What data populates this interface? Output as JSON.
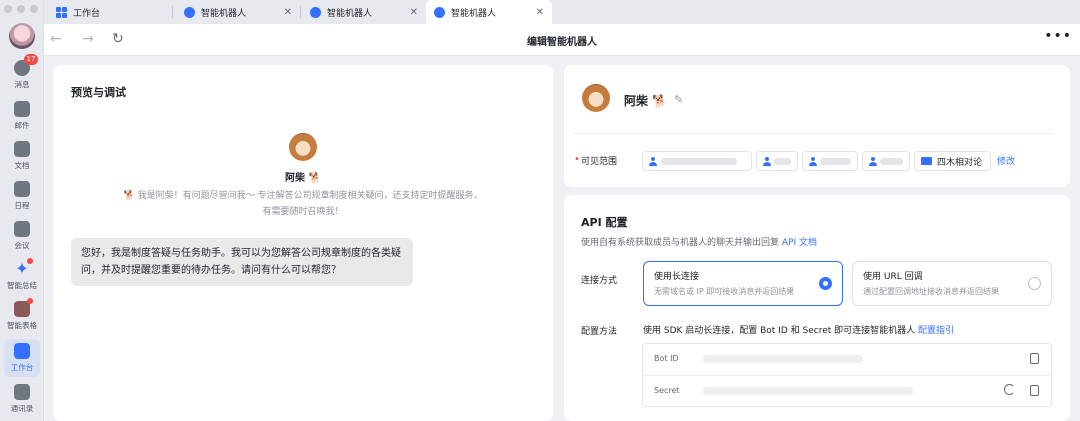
{
  "sidebar": {
    "badge_count": "17",
    "items": [
      {
        "label": "消息"
      },
      {
        "label": "邮件"
      },
      {
        "label": "文档"
      },
      {
        "label": "日程"
      },
      {
        "label": "会议"
      },
      {
        "label": "智能总结"
      },
      {
        "label": "智能表格"
      },
      {
        "label": "工作台"
      },
      {
        "label": "通讯录"
      }
    ]
  },
  "tabs": [
    {
      "label": "工作台"
    },
    {
      "label": "智能机器人"
    },
    {
      "label": "智能机器人"
    },
    {
      "label": "智能机器人"
    }
  ],
  "toolbar": {
    "title": "编辑智能机器人",
    "more": "•••",
    "back": "←",
    "forward": "→",
    "reload": "↻"
  },
  "preview": {
    "title": "预览与调试",
    "bot_name": "阿柴 🐕",
    "intro_line1": "🐕 我是阿柴！有问题尽管问我～ 专注解答公司规章制度相关疑问，还支持定时提醒服务，",
    "intro_line2": "有需要随时召唤我！",
    "message": "您好，我是制度答疑与任务助手。我可以为您解答公司规章制度的各类疑问，并及时提醒您重要的待办任务。请问有什么可以帮您？"
  },
  "bot": {
    "name": "阿柴 🐕",
    "edit_icon": "✎",
    "scope_label": "可见范围",
    "required_mark": "•",
    "group_chip": "四木相对论",
    "modify_link": "修改"
  },
  "api": {
    "title": "API 配置",
    "desc": "使用自有系统获取成员与机器人的聊天并输出回复",
    "doc_link": "API 文档",
    "connection_label": "连接方式",
    "options": [
      {
        "title": "使用长连接",
        "desc": "无需域名或 IP 即可接收消息并返回结果",
        "selected": true
      },
      {
        "title": "使用 URL 回调",
        "desc": "通过配置回调地址接收消息并返回结果",
        "selected": false
      }
    ],
    "config_label": "配置方法",
    "config_desc": "使用 SDK 启动长连接，配置 Bot ID 和 Secret 即可连接智能机器人",
    "config_link": "配置指引",
    "fields": [
      {
        "label": "Bot ID"
      },
      {
        "label": "Secret"
      }
    ]
  },
  "colors": {
    "accent": "#3370ff",
    "badge": "#f54a45"
  }
}
